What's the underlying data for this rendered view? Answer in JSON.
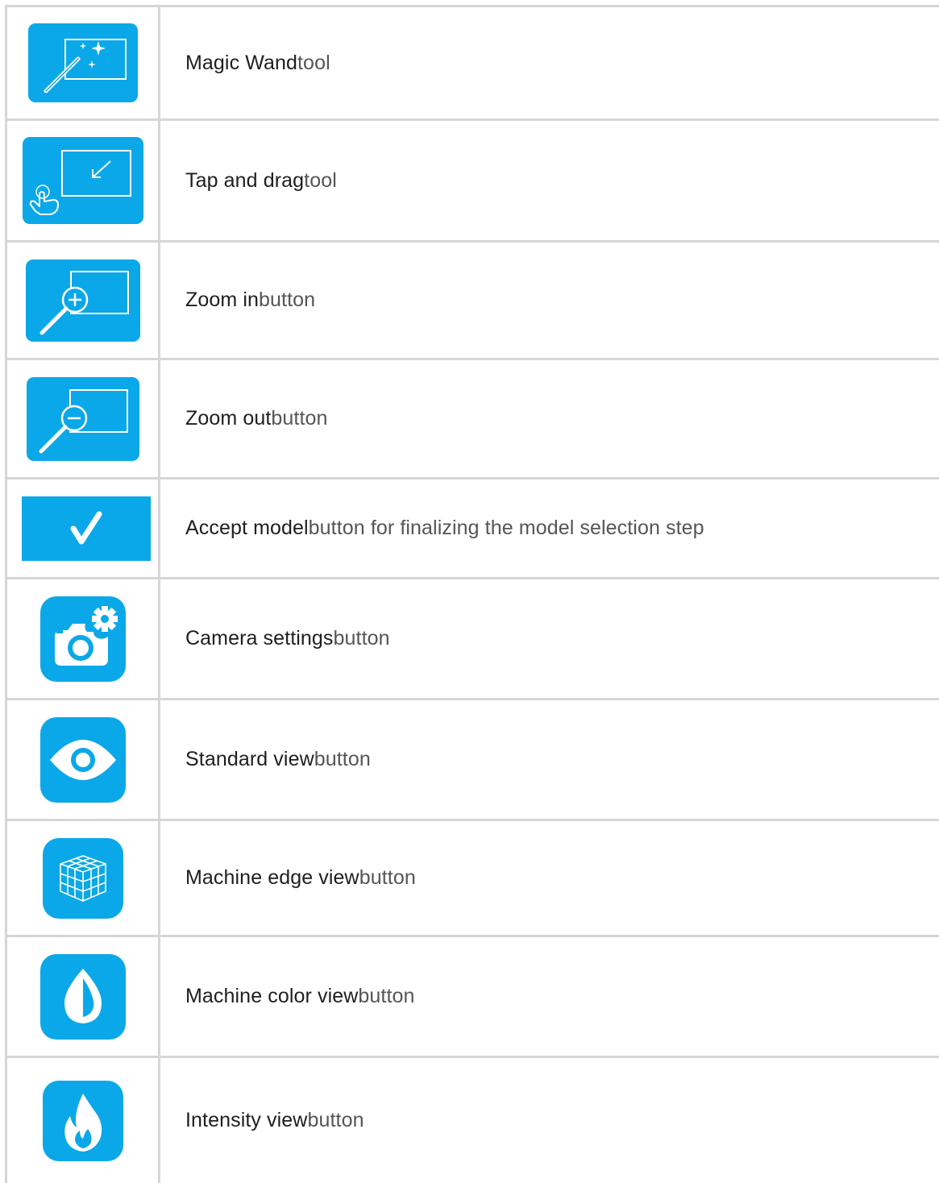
{
  "colors": {
    "accent": "#0aa8e8",
    "border": "#d6d6d6",
    "icon_fg": "#ffffff"
  },
  "rows": [
    {
      "icon": "magic-wand-icon",
      "name": "Magic Wand",
      "suffix": " tool"
    },
    {
      "icon": "tap-and-drag-icon",
      "name": "Tap and drag",
      "suffix": " tool"
    },
    {
      "icon": "zoom-in-icon",
      "name": "Zoom in",
      "suffix": " button"
    },
    {
      "icon": "zoom-out-icon",
      "name": "Zoom out",
      "suffix": " button"
    },
    {
      "icon": "checkmark-icon",
      "name": "Accept model",
      "suffix": " button for finalizing the model selection step"
    },
    {
      "icon": "camera-settings-icon",
      "name": "Camera settings",
      "suffix": " button"
    },
    {
      "icon": "eye-icon",
      "name": "Standard view",
      "suffix": " button"
    },
    {
      "icon": "cube-wireframe-icon",
      "name": "Machine edge view",
      "suffix": " button"
    },
    {
      "icon": "droplet-icon",
      "name": "Machine color view",
      "suffix": " button"
    },
    {
      "icon": "flame-icon",
      "name": "Intensity view",
      "suffix": " button"
    }
  ]
}
